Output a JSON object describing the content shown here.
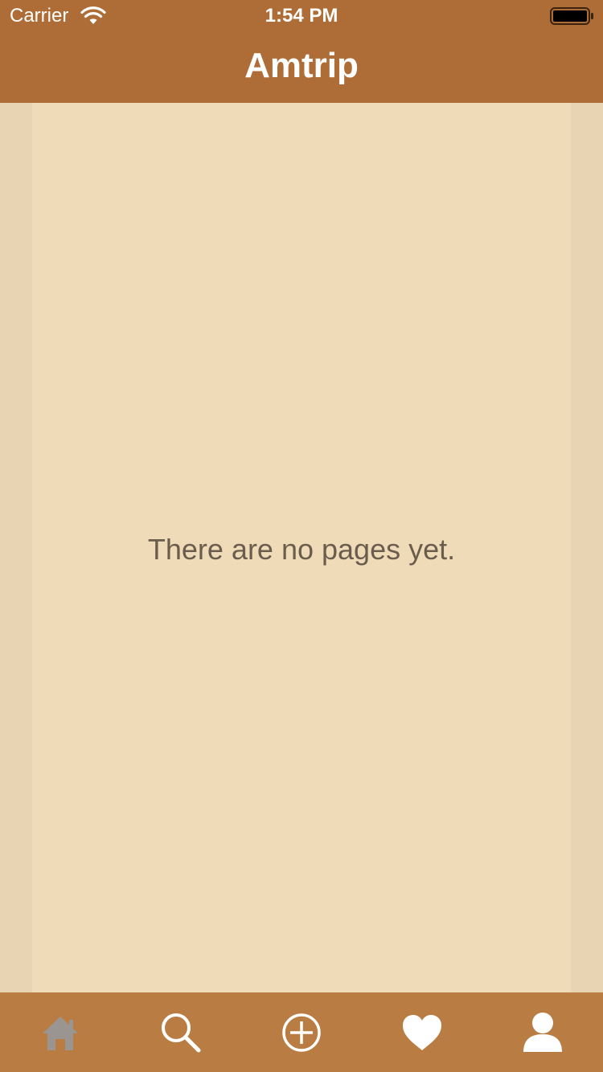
{
  "status_bar": {
    "carrier": "Carrier",
    "time": "1:54 PM",
    "wifi_icon": "wifi-icon",
    "battery_icon": "battery-icon"
  },
  "nav": {
    "title": "Amtrip"
  },
  "main": {
    "empty_message": "There are no pages yet."
  },
  "tab_bar": {
    "items": [
      {
        "icon": "home-icon",
        "selected": true
      },
      {
        "icon": "search-icon",
        "selected": false
      },
      {
        "icon": "add-circle-icon",
        "selected": false
      },
      {
        "icon": "heart-icon",
        "selected": false
      },
      {
        "icon": "user-icon",
        "selected": false
      }
    ]
  },
  "colors": {
    "header": "#ae6d37",
    "tab_bar": "#b97d44",
    "content_background": "#f0dbb9",
    "page_background": "#e8d4b2",
    "text": "#6b5d4e",
    "tab_inactive": "#ffffff",
    "tab_selected": "#9a9590"
  }
}
